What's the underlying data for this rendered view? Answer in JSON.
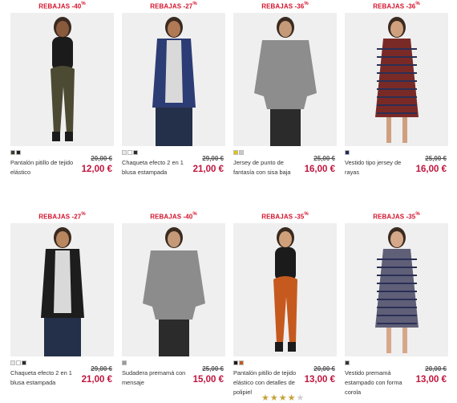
{
  "products": [
    {
      "discount": "REBAJAS -40%",
      "name": "Pantalón pitillo de tejido elástico",
      "old_price": "20,00 €",
      "new_price": "12,00 €",
      "swatches": [
        "#3d3a2e",
        "#222"
      ],
      "garment": "#4d4a33",
      "skin": "#8a5a3c",
      "style": "pants"
    },
    {
      "discount": "REBAJAS -27%",
      "name": "Chaqueta efecto 2 en 1 blusa estampada",
      "old_price": "29,00 €",
      "new_price": "21,00 €",
      "swatches": [
        "#e8e8e8",
        "#fff",
        "#2b2b2b"
      ],
      "garment": "#2c3c74",
      "skin": "#b07a57",
      "style": "cardigan"
    },
    {
      "discount": "REBAJAS -36%",
      "name": "Jersey de punto de fantasía con sisa baja",
      "old_price": "25,00 €",
      "new_price": "16,00 €",
      "swatches": [
        "#e2c400",
        "#c9c9c9"
      ],
      "garment": "#8d8d8d",
      "skin": "#c49a78",
      "style": "sweater"
    },
    {
      "discount": "REBAJAS -36%",
      "name": "Vestido tipo jersey de rayas",
      "old_price": "25,00 €",
      "new_price": "16,00 €",
      "swatches": [
        "#1e2a55"
      ],
      "garment": "#7a2a26",
      "skin": "#d0a07e",
      "style": "dress"
    },
    {
      "discount": "REBAJAS -27%",
      "name": "Chaqueta efecto 2 en 1 blusa estampada",
      "old_price": "29,00 €",
      "new_price": "21,00 €",
      "swatches": [
        "#e8e8e8",
        "#fff",
        "#2b2b2b"
      ],
      "garment": "#1d1d1d",
      "skin": "#b8865f",
      "style": "cardigan"
    },
    {
      "discount": "REBAJAS -40%",
      "name": "Sudadera premamá con mensaje",
      "old_price": "25,00 €",
      "new_price": "15,00 €",
      "swatches": [
        "#9a9a9a"
      ],
      "garment": "#8c8c8c",
      "skin": "#c49a78",
      "style": "sweater"
    },
    {
      "discount": "REBAJAS -35%",
      "name": "Pantalón pitillo de tejido elástico con detalles de polipiel",
      "old_price": "20,00 €",
      "new_price": "13,00 €",
      "swatches": [
        "#1a1a1a",
        "#c45a1c"
      ],
      "garment": "#c65a1e",
      "skin": "#cfa07a",
      "style": "pants"
    },
    {
      "discount": "REBAJAS -35%",
      "name": "Vestido premamá estampado con forma corola",
      "old_price": "20,00 €",
      "new_price": "13,00 €",
      "swatches": [
        "#333"
      ],
      "garment": "#5f5f78",
      "skin": "#d6a88a",
      "style": "dress"
    }
  ],
  "rating": {
    "filled": "★★★★",
    "empty": "★"
  }
}
